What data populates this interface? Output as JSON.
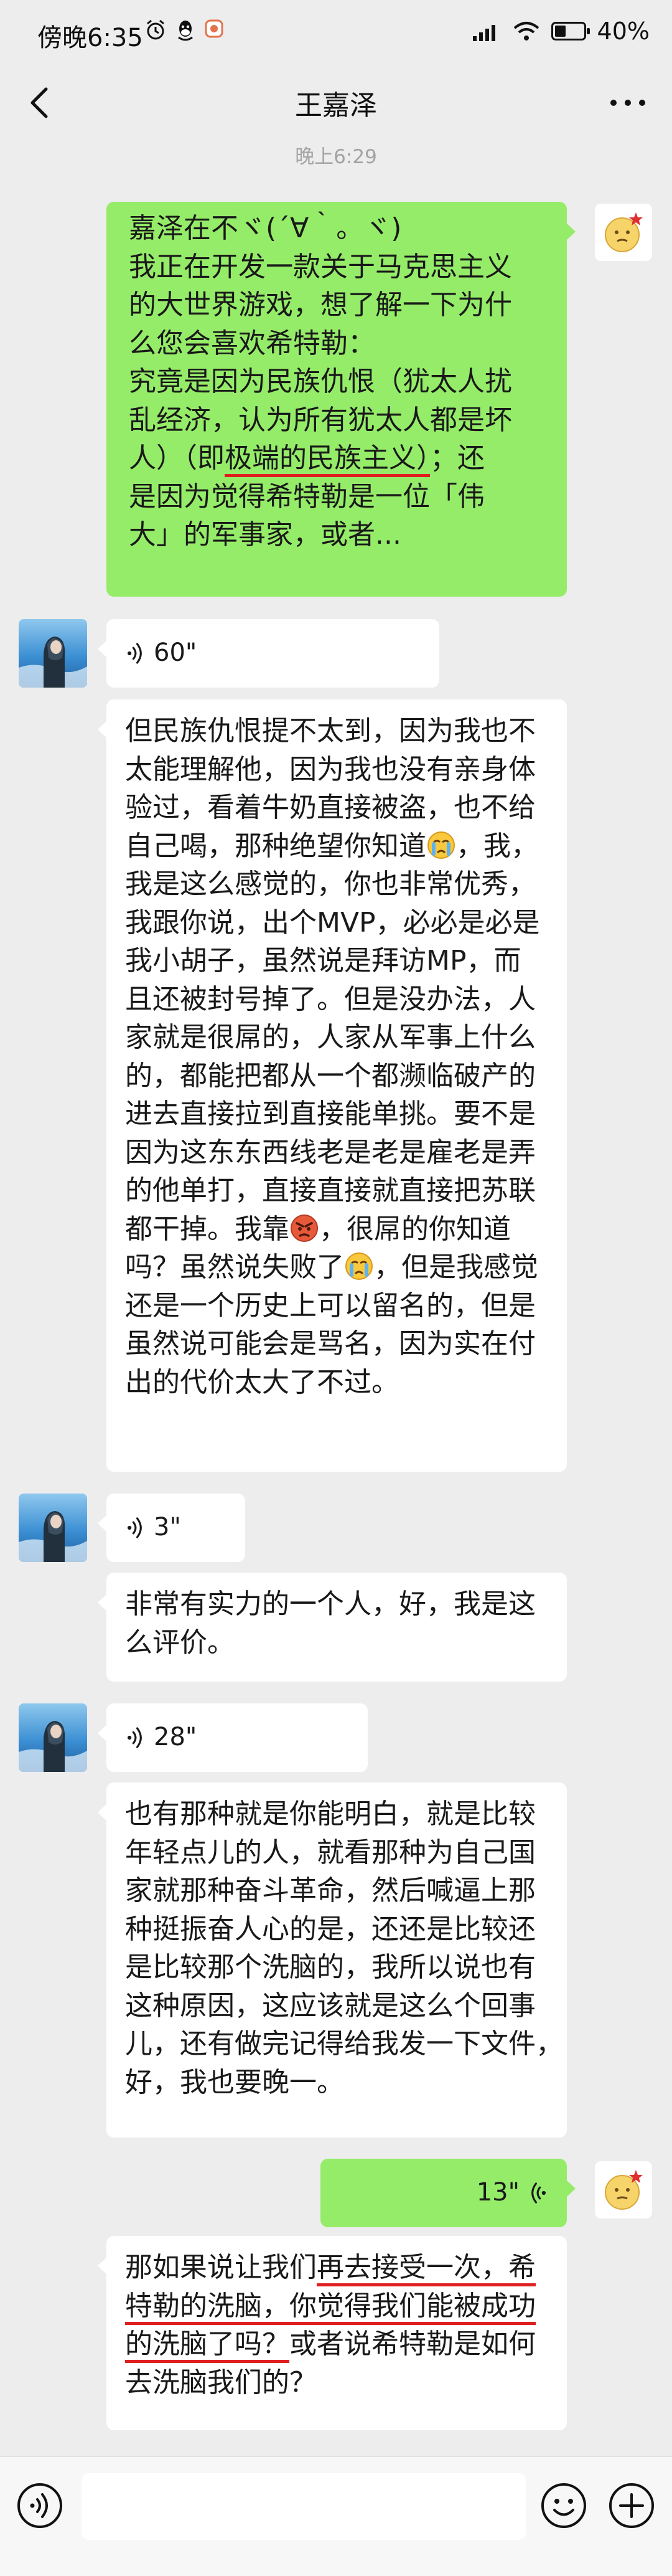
{
  "status": {
    "time": "傍晚6:35",
    "battery": "40%",
    "battery_level": 0.4
  },
  "nav": {
    "title": "王嘉泽"
  },
  "timestamp": "晚上6:29",
  "messages": {
    "m1": {
      "lines": [
        "嘉泽在不ヾ(´∀｀。ヾ)",
        "我正在开发一款关于马克思主义",
        "的大世界游戏，想了解一下为什",
        "么您会喜欢希特勒：",
        "究竟是因为民族仇恨（犹太人扰",
        "乱经济，认为所有犹太人都是坏",
        "人）（即",
        "极端的民族主义）",
        "；还",
        "是因为觉得希特勒是一位「伟",
        "大」的军事家，或者..."
      ]
    },
    "m2": {
      "duration": "60\""
    },
    "m3": {
      "lines": [
        "但民族仇恨提不太到，因为我也不",
        "太能理解他，因为我也没有亲身体",
        "验过，看着牛奶直接被盗，也不给",
        "自己喝，那种绝望你知道",
        "，我，",
        "我是这么感觉的，你也非常优秀，",
        "我跟你说，出个MVP，必必是必是",
        "我小胡子，虽然说是拜访MP，而",
        "且还被封号掉了。但是没办法，人",
        "家就是很屌的，人家从军事上什么",
        "的，都能把都从一个都濒临破产的",
        "进去直接拉到直接能单挑。要不是",
        "因为这东东西线老是老是雇老是弄",
        "的他单打，直接直接就直接把苏联",
        "都干掉。我靠",
        "，很屌的你知道",
        "吗？虽然说失败了",
        "，但是我感觉",
        "还是一个历史上可以留名的，但是",
        "虽然说可能会是骂名，因为实在付",
        "出的代价太大了不过。"
      ]
    },
    "m4": {
      "duration": "3\""
    },
    "m5": {
      "lines": [
        "非常有实力的一个人，好，我是这",
        "么评价。"
      ]
    },
    "m6": {
      "duration": "28\""
    },
    "m7": {
      "lines": [
        "也有那种就是你能明白，就是比较",
        "年轻点儿的人，就看那种为自己国",
        "家就那种奋斗革命，然后喊逼上那",
        "种挺振奋人心的是，还还是比较还",
        "是比较那个洗脑的，我所以说也有",
        "这种原因，这应该就是这么个回事",
        "儿，还有做完记得给我发一下文件，",
        "好，我也要晚一。"
      ]
    },
    "m8": {
      "duration": "13\""
    },
    "m9": {
      "lines": [
        "那如果说让我们",
        "再去接受一次，希",
        "特勒的洗脑，你觉得我们能被成功",
        "的洗脑了吗？",
        "或者说希特勒是如何",
        "去洗脑我们的？"
      ]
    }
  },
  "colors": {
    "background": "#ededed",
    "bubble_green": "#95ec69",
    "bubble_white": "#ffffff",
    "timestamp": "#a3a3a3",
    "underline": "#e02020"
  },
  "icons": {
    "back": "chevron-left-icon",
    "more": "more-dots-icon",
    "voice": "voice-wave-icon",
    "emoji": "emoji-face-icon",
    "plus": "plus-icon"
  }
}
